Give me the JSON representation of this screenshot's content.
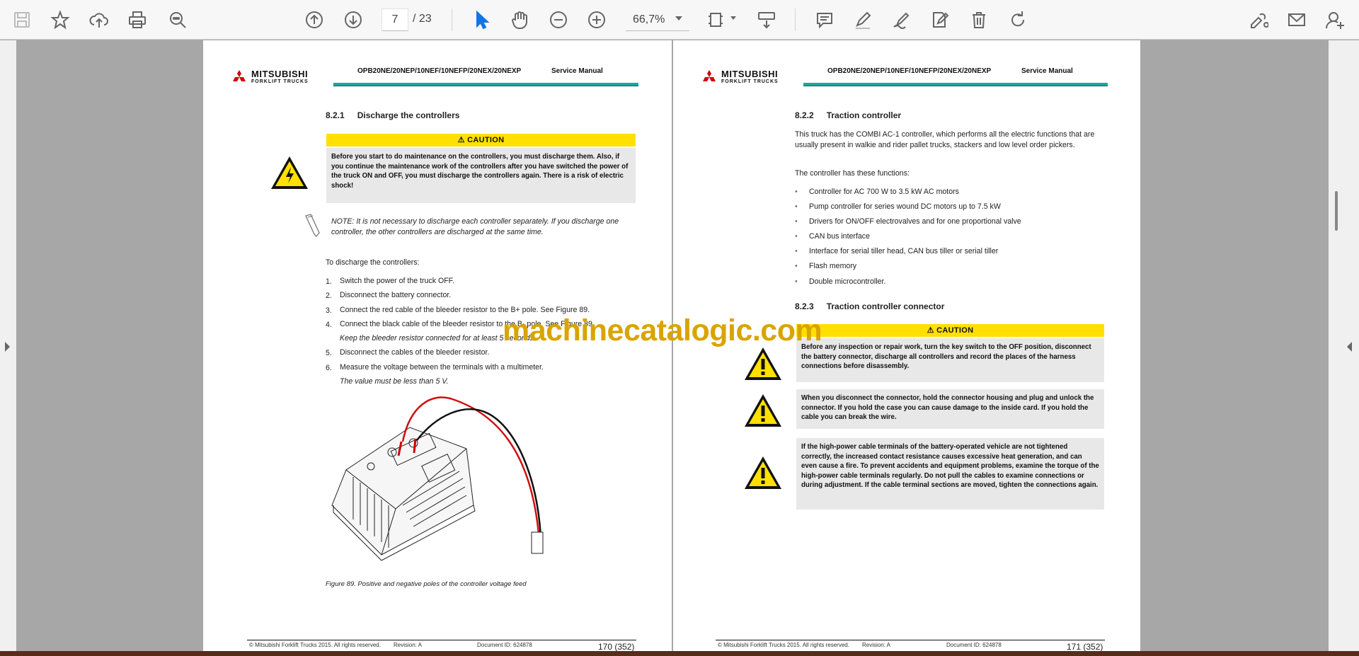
{
  "toolbar": {
    "page_current": "7",
    "page_sep": "/",
    "page_total": "23",
    "zoom": "66,7%"
  },
  "watermark": "machinecatalogic.com",
  "left_page": {
    "logo": "MITSUBISHI",
    "logo_sub": "FORKLIFT TRUCKS",
    "model": "OPB20NE/20NEP/10NEF/10NEFP/20NEX/20NEXP",
    "manual": "Service Manual",
    "section_num": "8.2.1",
    "section_title": "Discharge the controllers",
    "caution_label": "CAUTION",
    "caution_text": "Before you start to do maintenance on the controllers, you must discharge them. Also, if you continue the maintenance work of the controllers after you have switched the power of the truck ON and OFF, you must discharge the controllers again. There is a risk of electric shock!",
    "note": "NOTE: It is not necessary to discharge each controller separately. If you discharge one controller, the other controllers are discharged at the same time.",
    "intro": "To discharge the controllers:",
    "steps": [
      {
        "n": "1.",
        "t": "Switch the power of the truck OFF."
      },
      {
        "n": "2.",
        "t": "Disconnect the battery connector."
      },
      {
        "n": "3.",
        "t": "Connect the red cable of the bleeder resistor to the B+ pole. See Figure 89."
      },
      {
        "n": "4.",
        "t": "Connect the black cable of the bleeder resistor to the B- pole. See Figure 89."
      },
      {
        "n": "",
        "t": "Keep the bleeder resistor connected for at least 5 seconds."
      },
      {
        "n": "5.",
        "t": "Disconnect the cables of the bleeder resistor."
      },
      {
        "n": "6.",
        "t": "Measure the voltage between the terminals with a multimeter."
      },
      {
        "n": "",
        "t": "The value must be less than 5 V."
      }
    ],
    "figure_caption": "Figure 89. Positive and negative poles of the controller voltage feed",
    "footer_copy": "© Mitsubishi Forklift Trucks 2015. All rights reserved.",
    "footer_rev": "Revision: A",
    "footer_doc": "Document ID: 624878",
    "page_num": "170 (352)"
  },
  "right_page": {
    "logo": "MITSUBISHI",
    "logo_sub": "FORKLIFT TRUCKS",
    "model": "OPB20NE/20NEP/10NEF/10NEFP/20NEX/20NEXP",
    "manual": "Service Manual",
    "section_num": "8.2.2",
    "section_title": "Traction controller",
    "intro": "This truck has the COMBI AC-1 controller, which performs all the electric functions that are usually present in walkie and rider pallet trucks, stackers and low level order pickers.",
    "functions_intro": "The controller has these functions:",
    "functions": [
      "Controller for AC 700 W to 3.5 kW AC motors",
      "Pump controller for series wound DC motors up to 7.5 kW",
      "Drivers for ON/OFF electrovalves and for one proportional valve",
      "CAN bus interface",
      "Interface for serial tiller head, CAN bus tiller or serial tiller",
      "Flash memory",
      "Double microcontroller."
    ],
    "section2_num": "8.2.3",
    "section2_title": "Traction controller connector",
    "caution_label": "CAUTION",
    "cautions": [
      "Before any inspection or repair work, turn the key switch to the OFF position, disconnect the battery connector, discharge all controllers and record the places of the harness connections before disassembly.",
      "When you disconnect the connector, hold the connector housing and plug and unlock the connector. If you hold the case you can cause damage to the inside card. If you hold the cable you can break the wire.",
      "If the high-power cable terminals of the battery-operated vehicle are not tightened correctly, the increased contact resistance causes excessive heat generation, and can even cause a fire. To prevent accidents and equipment problems, examine the torque of the high-power cable terminals regularly. Do not pull the cables to examine connections or during adjustment. If the cable terminal sections are moved, tighten the connections again."
    ],
    "footer_copy": "© Mitsubishi Forklift Trucks 2015. All rights reserved.",
    "footer_rev": "Revision: A",
    "footer_doc": "Document ID: 624878",
    "page_num": "171 (352)"
  }
}
